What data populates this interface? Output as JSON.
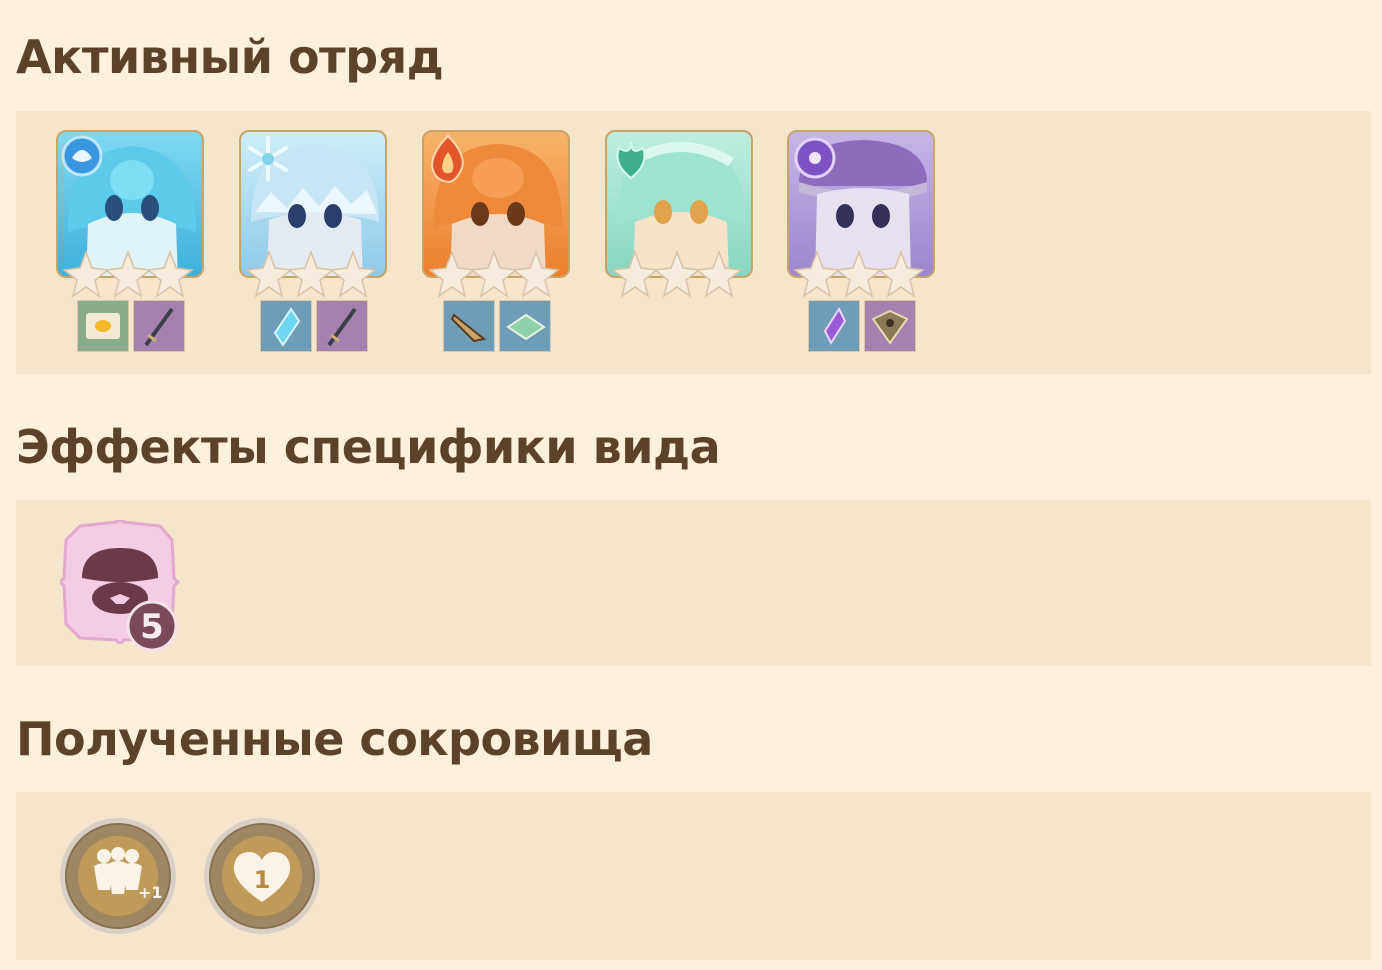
{
  "sections": {
    "team": {
      "title": "Активный отряд"
    },
    "effects": {
      "title": "Эффекты специфики вида"
    },
    "treasures": {
      "title": "Полученные сокровища"
    }
  },
  "team": [
    {
      "element": "hydro-icon",
      "color": "#5cc8e8",
      "items": [
        "food-plate-icon",
        "sword-icon"
      ],
      "stars": 3
    },
    {
      "element": "cryo-icon",
      "color": "#a9dcf2",
      "items": [
        "crystal-shard-icon",
        "sword-icon"
      ],
      "stars": 3
    },
    {
      "element": "pyro-icon",
      "color": "#f0883c",
      "items": [
        "arrowhead-icon",
        "tome-icon"
      ],
      "stars": 3
    },
    {
      "element": "anemo-icon",
      "color": "#7fd8c2",
      "items": [],
      "stars": 3
    },
    {
      "element": "electro-icon",
      "color": "#a08ad0",
      "items": [
        "purple-crystal-icon",
        "shuriken-icon"
      ],
      "stars": 3
    }
  ],
  "effect": {
    "icon": "mushroom-effect-icon",
    "level": "5"
  },
  "treasure_items": [
    {
      "icon": "team-plus-icon",
      "badge": "+1"
    },
    {
      "icon": "heart-icon",
      "badge": "1"
    }
  ]
}
